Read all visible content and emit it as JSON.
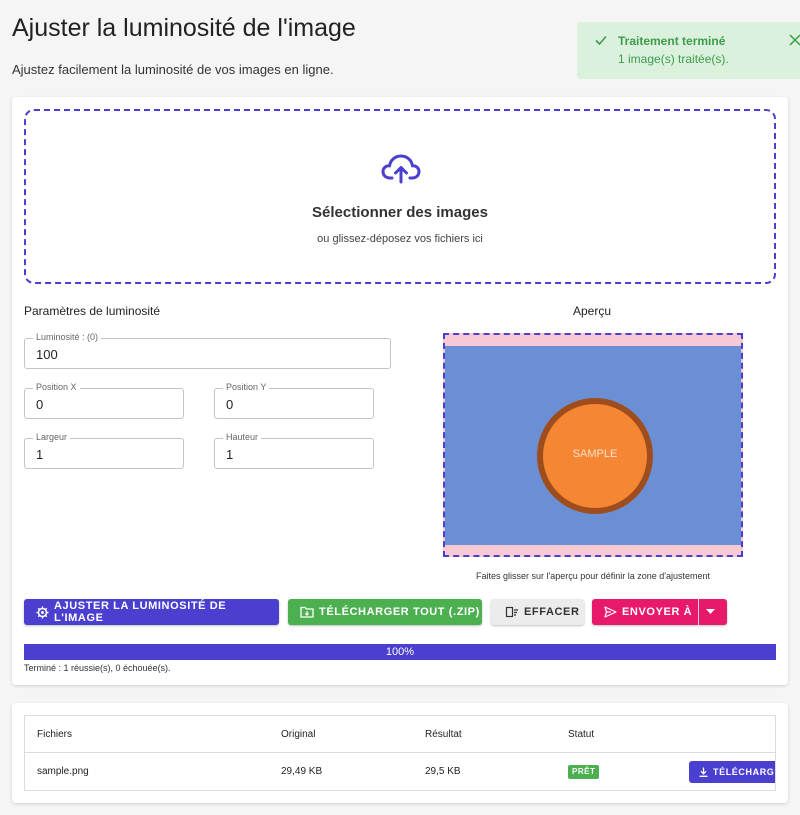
{
  "header": {
    "title": "Ajuster la luminosité de l'image",
    "subtitle": "Ajustez facilement la luminosité de vos images en ligne."
  },
  "toast": {
    "title": "Traitement terminé",
    "message": "1 image(s) traitée(s).",
    "icon": "check-icon",
    "close_icon": "close-icon",
    "color": "#3d9c4c"
  },
  "dropzone": {
    "icon": "cloud-upload-icon",
    "title": "Sélectionner des images",
    "subtitle": "ou glissez-déposez vos fichiers ici"
  },
  "params": {
    "title": "Paramètres de luminosité",
    "brightness": {
      "label": "Luminosité : (0)",
      "value": "100"
    },
    "pos_x": {
      "label": "Position X",
      "value": "0"
    },
    "pos_y": {
      "label": "Position Y",
      "value": "0"
    },
    "width": {
      "label": "Largeur",
      "value": "1"
    },
    "height": {
      "label": "Hauteur",
      "value": "1"
    }
  },
  "preview": {
    "title": "Aperçu",
    "sample_label": "SAMPLE",
    "hint": "Faites glisser sur l'aperçu pour définir la zone d'ajustement"
  },
  "actions": {
    "adjust": "AJUSTER LA LUMINOSITÉ DE L'IMAGE",
    "download_all": "TÉLÉCHARGER TOUT (.ZIP)",
    "clear": "EFFACER",
    "send_to": "ENVOYER À"
  },
  "progress": {
    "value": 100,
    "label": "100%",
    "status": "Terminé : 1 réussie(s), 0 échouée(s)."
  },
  "table": {
    "headers": [
      "Fichiers",
      "Original",
      "Résultat",
      "Statut"
    ],
    "rows": [
      {
        "file": "sample.png",
        "original": "29,49 KB",
        "result": "29,5 KB",
        "status": "PRÊT",
        "action": "TÉLÉCHARGER"
      }
    ]
  },
  "colors": {
    "accent": "#4b3fcf",
    "success": "#4caf50",
    "send": "#e8196b"
  }
}
